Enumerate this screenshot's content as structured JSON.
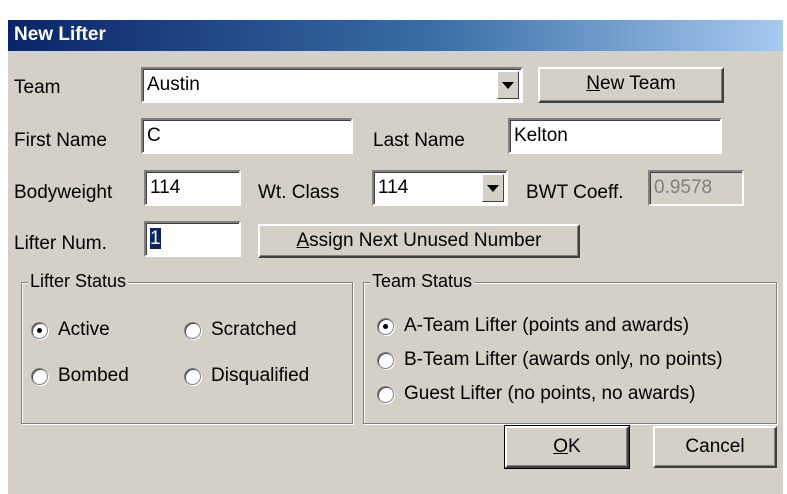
{
  "window": {
    "title": "New Lifter"
  },
  "team": {
    "label": "Team",
    "value": "Austin",
    "new_team_prefix": "N",
    "new_team_rest": "ew Team"
  },
  "first_name": {
    "label": "First Name",
    "value": "C"
  },
  "last_name": {
    "label": "Last Name",
    "value": "Kelton"
  },
  "bodyweight": {
    "label": "Bodyweight",
    "value": "114"
  },
  "wt_class": {
    "label": "Wt. Class",
    "value": "114"
  },
  "bwt_coeff": {
    "label": "BWT Coeff.",
    "value": "0.9578"
  },
  "lifter_num": {
    "label": "Lifter Num.",
    "value": "1",
    "assign_prefix": "A",
    "assign_rest": "ssign Next Unused Number"
  },
  "lifter_status": {
    "title": "Lifter Status",
    "options": [
      "Active",
      "Scratched",
      "Bombed",
      "Disqualified"
    ],
    "selected": "Active"
  },
  "team_status": {
    "title": "Team Status",
    "options": [
      "A-Team Lifter (points and awards)",
      "B-Team Lifter (awards only, no points)",
      "Guest Lifter (no points, no awards)"
    ],
    "selected": "A-Team Lifter (points and awards)"
  },
  "buttons": {
    "ok_prefix": "O",
    "ok_rest": "K",
    "cancel": "Cancel"
  }
}
